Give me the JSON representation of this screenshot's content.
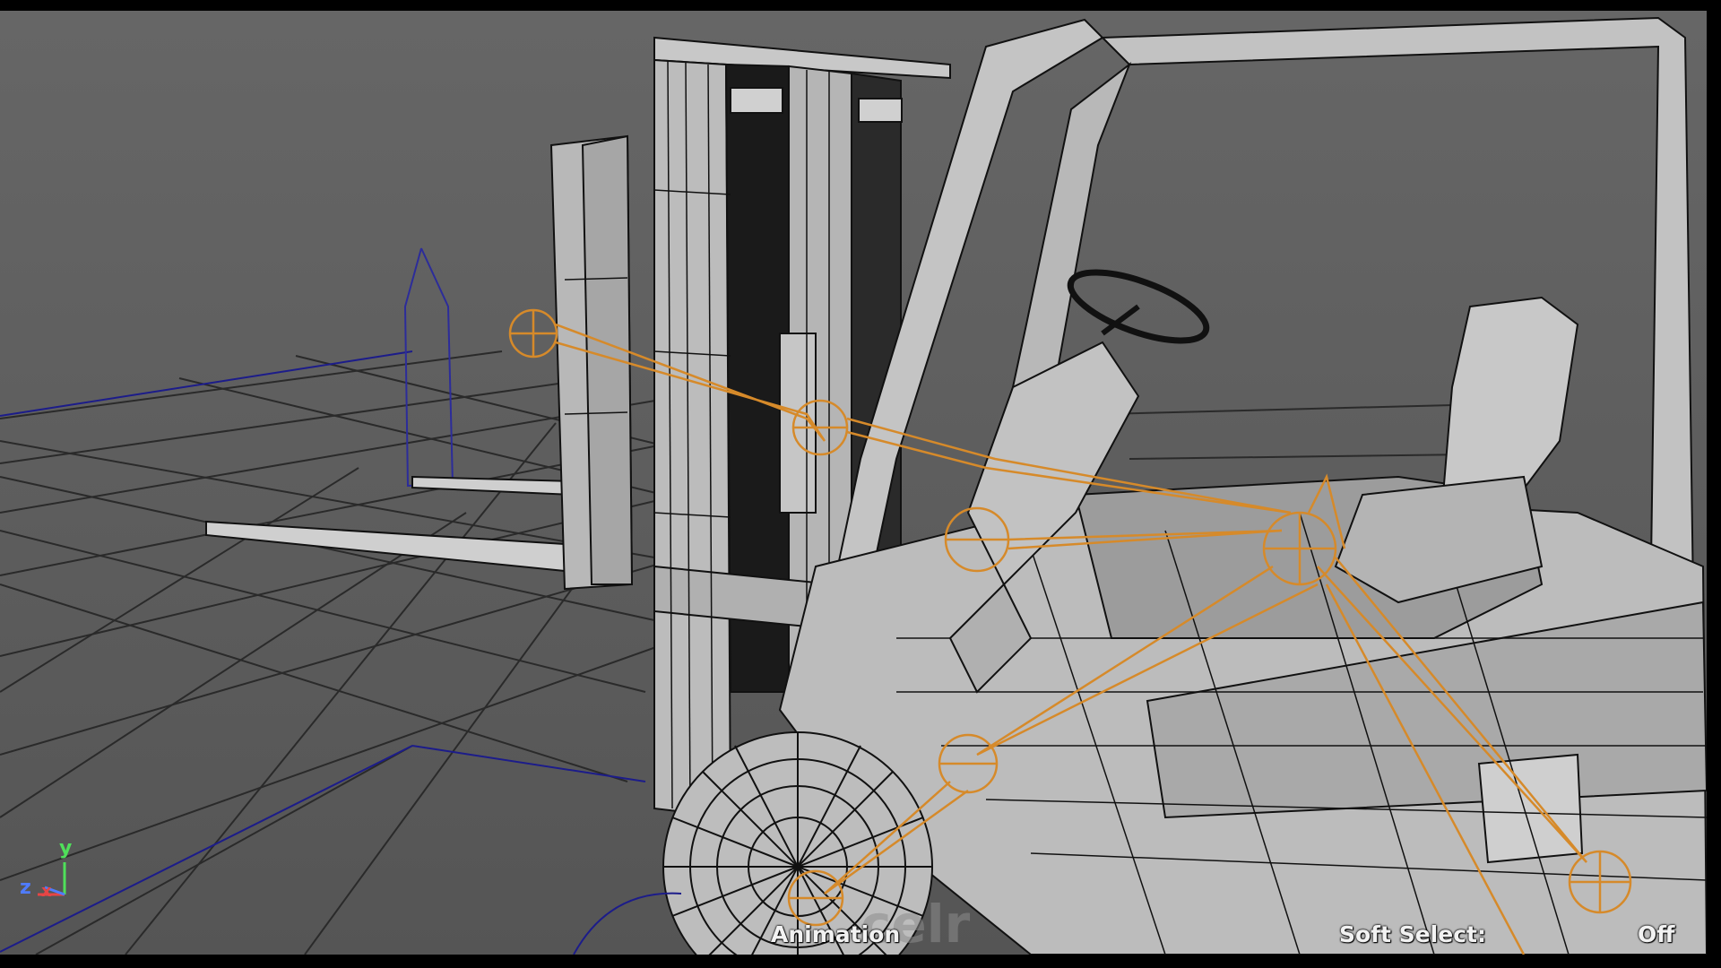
{
  "viewport": {
    "hud": {
      "mode": "Animation",
      "soft_select_label": "Soft Select:",
      "soft_select_value": "Off"
    },
    "watermark": "celr",
    "axis": {
      "y": "y",
      "z": "z",
      "x": "x"
    }
  },
  "colors": {
    "background": "#5f5f5f",
    "grid": "#2a2a2a",
    "grid_axis": "#1c1c8a",
    "joint": "#d68a2a",
    "mesh_fill": "#bdbdbd",
    "mesh_line": "#111111",
    "locator": "#2c2c9a"
  },
  "icons": [
    "axis-gizmo-icon"
  ]
}
